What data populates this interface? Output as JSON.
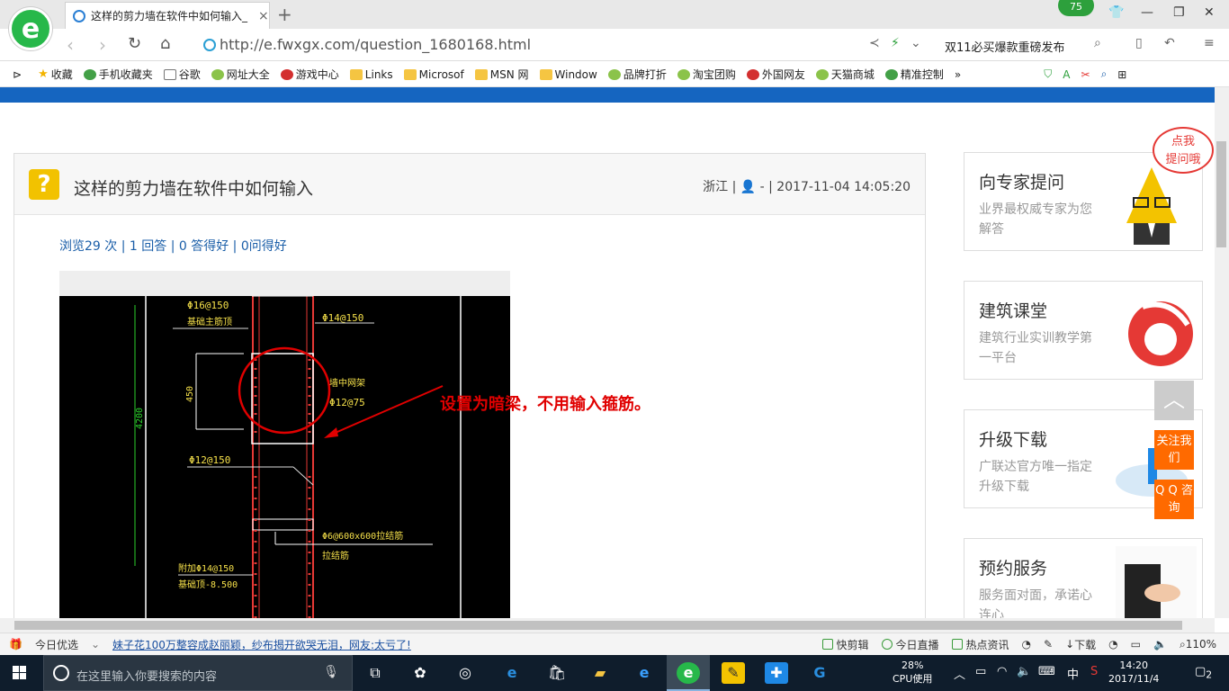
{
  "browser": {
    "tab_title": "这样的剪力墙在软件中如何输入_",
    "tab_close": "×",
    "new_tab": "+",
    "badge_count": "75",
    "url": "http://e.fwxgx.com/question_1680168.html",
    "promo_text": "双11必买爆款重磅发布"
  },
  "bookmarks": [
    {
      "label": "收藏",
      "icon": "star"
    },
    {
      "label": "手机收藏夹",
      "icon": "green"
    },
    {
      "label": "谷歌",
      "icon": "doc"
    },
    {
      "label": "网址大全",
      "icon": "leaf"
    },
    {
      "label": "游戏中心",
      "icon": "red"
    },
    {
      "label": "Links",
      "icon": "folder"
    },
    {
      "label": "Microsof",
      "icon": "folder"
    },
    {
      "label": "MSN 网",
      "icon": "folder"
    },
    {
      "label": "Window",
      "icon": "folder"
    },
    {
      "label": "品牌打折",
      "icon": "leaf"
    },
    {
      "label": "淘宝团购",
      "icon": "leaf"
    },
    {
      "label": "外国网友",
      "icon": "red"
    },
    {
      "label": "天猫商城",
      "icon": "leaf"
    },
    {
      "label": "精准控制",
      "icon": "green"
    }
  ],
  "bookmarks_more": "»",
  "question": {
    "icon": "?",
    "title": "这样的剪力墙在软件中如何输入",
    "meta": "浙江 | 👤 - | 2017-11-04 14:05:20",
    "stats": "浏览29 次 | 1 回答 | 0 答得好 | 0问得好",
    "annotation": "设置为暗梁，不用输入箍筋。"
  },
  "cad_labels": {
    "top_left": "Φ16@150",
    "top_left_sub": "基础主筋顶",
    "top_right": "Φ14@150",
    "dim_450": "450",
    "dim_4200": "4200",
    "mid_right": "墙中网架",
    "mid_right_sub": "Φ12@75",
    "lower_left": "Φ12@150",
    "lower_right": "Φ6@600x600拉结筋",
    "lower_right_sub": "拉结筋",
    "bottom_left": "附加Φ14@150",
    "bottom_left_sub": "基础顶-8.500"
  },
  "sidebar": {
    "bubble": "点我\n提问哦",
    "cards": [
      {
        "title": "向专家提问",
        "desc": "业界最权威专家为您解答"
      },
      {
        "title": "建筑课堂",
        "desc": "建筑行业实训教学第一平台"
      },
      {
        "title": "升级下载",
        "desc": "广联达官方唯一指定升级下载"
      },
      {
        "title": "预约服务",
        "desc": "服务面对面，承诺心连心"
      }
    ],
    "float_top": "︿",
    "follow": "关注我们",
    "qq": "Q Q 咨询"
  },
  "statusbar": {
    "today": "今日优选",
    "news": "妹子花100万整容成赵丽颖，纱布揭开欲哭无泪，网友:太亏了!",
    "kuaijian": "快剪辑",
    "live": "今日直播",
    "hot": "热点资讯",
    "download": "下载",
    "zoom": "110%"
  },
  "taskbar": {
    "search_placeholder": "在这里输入你要搜索的内容",
    "cpu_pct": "28%",
    "cpu_label": "CPU使用",
    "ime": "中",
    "time": "14:20",
    "date": "2017/11/4",
    "notif": "2"
  },
  "colors": {
    "brand_blue": "#1565c0",
    "accent_orange": "#ff6a00",
    "annotation_red": "#e00000"
  }
}
